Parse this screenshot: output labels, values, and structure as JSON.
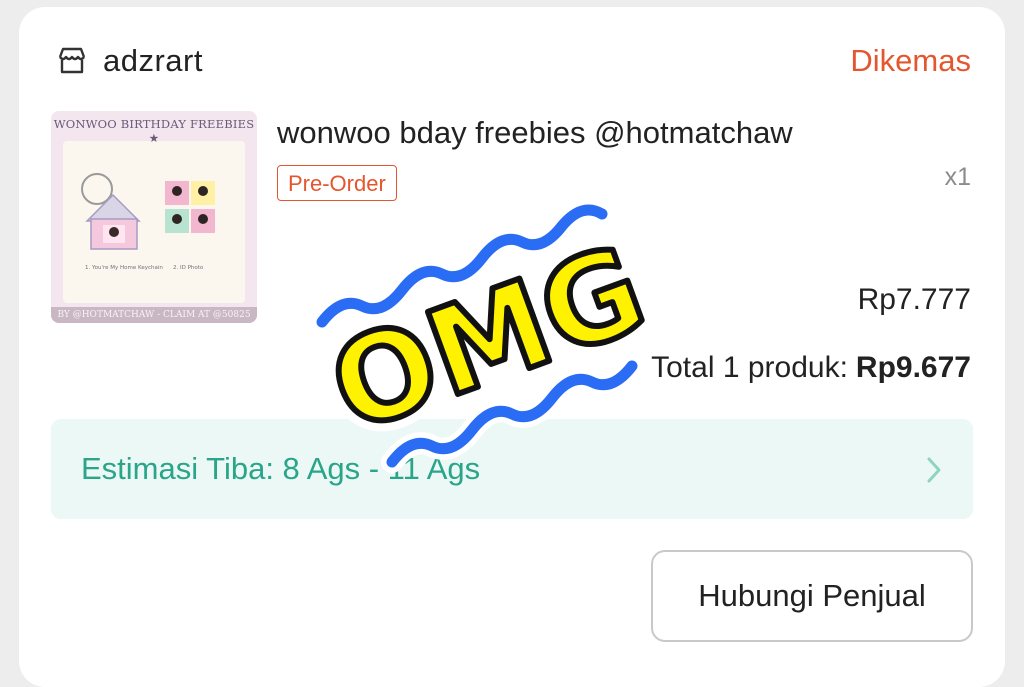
{
  "shop": {
    "name": "adzrart",
    "icon": "store-icon",
    "status": "Dikemas"
  },
  "product": {
    "name": "wonwoo bday freebies @hotmatchaw",
    "badge": "Pre-Order",
    "quantity": "x1",
    "price": "Rp7.777",
    "thumbnail": {
      "title": "WONWOO BIRTHDAY FREEBIES ★",
      "caption_1": "1. You're My Home Keychain",
      "caption_2": "2. ID Photo",
      "footer": "BY @HOTMATCHAW - CLAIM AT @50825"
    }
  },
  "summary": {
    "label": "Total 1 produk:",
    "value": "Rp9.677"
  },
  "delivery": {
    "eta": "Estimasi Tiba: 8 Ags - 11 Ags",
    "chevron_icon": "chevron-right-icon"
  },
  "actions": {
    "contact_label": "Hubungi Penjual"
  },
  "overlay": {
    "sticker_text": "OMG"
  },
  "colors": {
    "accent": "#e4572e",
    "eta_text": "#2aa58a",
    "eta_bg": "#ecf8f5",
    "sticker_fill": "#fff200",
    "sticker_stroke": "#2a6df4"
  }
}
